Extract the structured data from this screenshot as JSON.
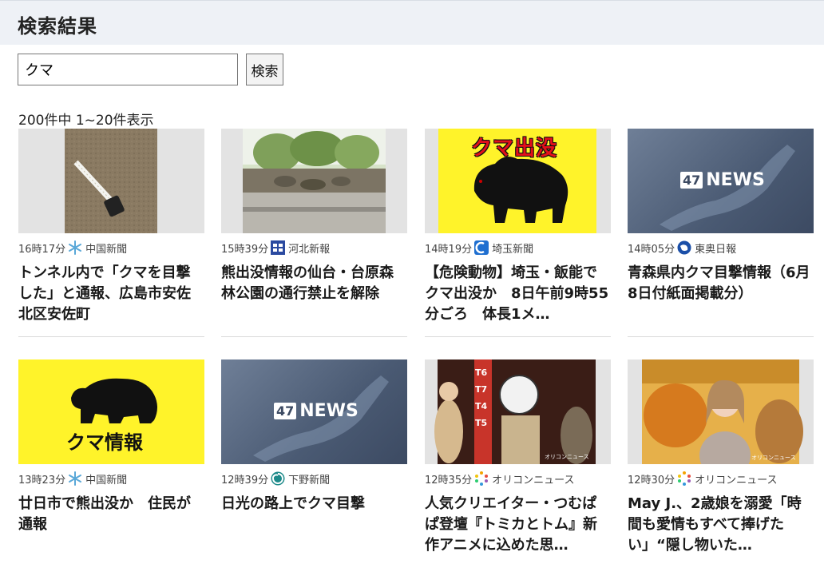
{
  "header": {
    "title": "検索結果"
  },
  "search": {
    "value": "クマ",
    "button_label": "検索"
  },
  "result_count": "200件中 1~20件表示",
  "colors": {
    "header_bg": "#eef1f6",
    "yellow": "#fff32a"
  },
  "cards": [
    {
      "time": "16時17分",
      "source": "中国新聞",
      "source_icon": "snowflake-icon",
      "title": "トンネル内で「クマを目撃した」と通報、広島市安佐北区安佐町",
      "thumb": "tape-measure-photo"
    },
    {
      "time": "15時39分",
      "source": "河北新報",
      "source_icon": "kahoku-logo-icon",
      "title": "熊出没情報の仙台・台原森林公園の通行禁止を解除",
      "thumb": "park-photo"
    },
    {
      "time": "14時19分",
      "source": "埼玉新聞",
      "source_icon": "saitama-logo-icon",
      "title": "【危険動物】埼玉・飯能でクマ出没か　8日午前9時55分ごろ　体長1メ…",
      "thumb": "bear-warning",
      "thumb_text": "クマ出没"
    },
    {
      "time": "14時05分",
      "source": "東奥日報",
      "source_icon": "globe-icon",
      "title": "青森県内クマ目撃情報（6月8日付紙面掲載分）",
      "thumb": "news47",
      "thumb_logo_box": "47",
      "thumb_logo_text": "NEWS"
    },
    {
      "time": "13時23分",
      "source": "中国新聞",
      "source_icon": "snowflake-icon",
      "title": "廿日市で熊出没か　住民が通報",
      "thumb": "bear-info",
      "thumb_text": "クマ情報"
    },
    {
      "time": "12時39分",
      "source": "下野新聞",
      "source_icon": "swirl-icon",
      "title": "日光の路上でクマ目撃",
      "thumb": "news47",
      "thumb_logo_box": "47",
      "thumb_logo_text": "NEWS"
    },
    {
      "time": "12時35分",
      "source": "オリコンニュース",
      "source_icon": "oricon-icon",
      "title": "人気クリエイター・つむぱぱ登壇『トミカとトム』新作アニメに込めた思…",
      "thumb": "stage-photo",
      "thumb_labels": [
        "T6",
        "T7",
        "T4",
        "T5"
      ],
      "thumb_watermark": "オリコンニュース"
    },
    {
      "time": "12時30分",
      "source": "オリコンニュース",
      "source_icon": "oricon-icon",
      "title": "May J.、2歳娘を溺愛「時間も愛情もすべて捧げたい」“隠し物いた…",
      "thumb": "event-photo",
      "thumb_watermark": "オリコンニュース"
    }
  ]
}
